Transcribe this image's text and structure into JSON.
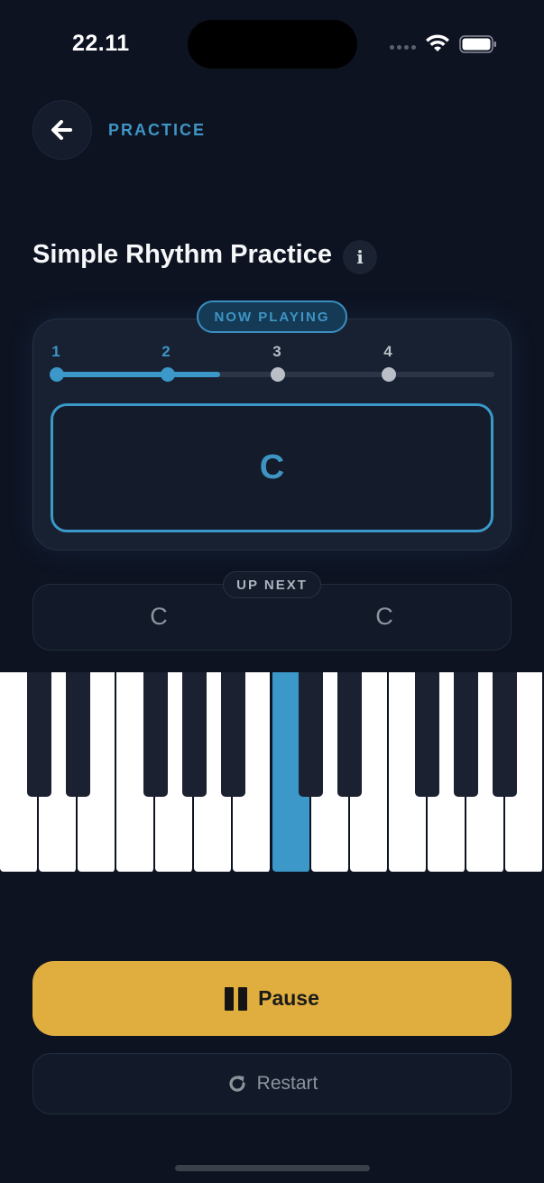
{
  "status_bar": {
    "time": "22.11"
  },
  "header": {
    "label": "PRACTICE"
  },
  "title": "Simple Rhythm Practice",
  "now_playing": {
    "badge": "NOW PLAYING",
    "beats": [
      "1",
      "2",
      "3",
      "4"
    ],
    "current_beat": 2,
    "progress": 0.38,
    "chord": "C"
  },
  "up_next": {
    "badge": "UP NEXT",
    "chords": [
      "C",
      "C"
    ]
  },
  "piano": {
    "white_keys": 14,
    "active_white_key_index": 7,
    "highlight_color": "#3b98c9"
  },
  "controls": {
    "pause_label": "Pause",
    "restart_label": "Restart"
  },
  "colors": {
    "accent": "#3b98c9",
    "primary_button": "#e0ae3f",
    "background": "#0e1322"
  },
  "icons": {
    "back": "arrow-left-icon",
    "info": "info-icon",
    "pause": "pause-icon",
    "restart": "restart-icon"
  }
}
